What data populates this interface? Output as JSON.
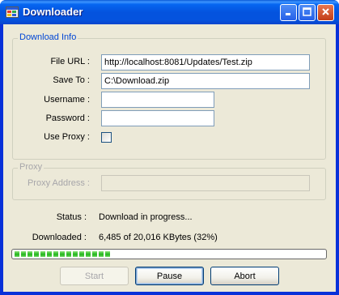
{
  "window": {
    "title": "Downloader",
    "icons": {
      "app": "app-window-icon",
      "minimize": "minimize-icon",
      "maximize": "maximize-icon",
      "close": "close-icon"
    }
  },
  "download_info": {
    "group_title": "Download Info",
    "file_url_label": "File URL :",
    "file_url_value": "http://localhost:8081/Updates/Test.zip",
    "save_to_label": "Save To :",
    "save_to_value": "C:\\Download.zip",
    "username_label": "Username :",
    "username_value": "",
    "password_label": "Password :",
    "password_value": "",
    "use_proxy_label": "Use Proxy :",
    "use_proxy_checked": false
  },
  "proxy": {
    "group_title": "Proxy",
    "address_label": "Proxy Address :",
    "address_value": ""
  },
  "status": {
    "status_label": "Status :",
    "status_value": "Download in progress...",
    "downloaded_label": "Downloaded :",
    "downloaded_value": "6,485 of 20,016 KBytes (32%)",
    "progress_percent": 32
  },
  "buttons": {
    "start": "Start",
    "pause": "Pause",
    "abort": "Abort"
  },
  "colors": {
    "titlebar": "#0453de",
    "group_title": "#0046d5",
    "progress": "#2fbb28",
    "client_bg": "#ece9d8"
  }
}
